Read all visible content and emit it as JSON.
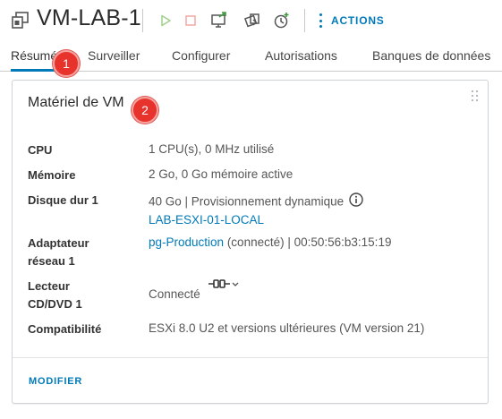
{
  "header": {
    "vm_name": "VM-LAB-1",
    "actions_label": "ACTIONS",
    "icons": [
      "vm-icon",
      "power-on-icon",
      "power-off-icon",
      "launch-console-icon",
      "migrate-icon",
      "snapshot-icon",
      "more-vertical-icon"
    ]
  },
  "tabs": [
    {
      "label": "Résumé",
      "active": true
    },
    {
      "label": "Surveiller"
    },
    {
      "label": "Configurer"
    },
    {
      "label": "Autorisations"
    },
    {
      "label": "Banques de données"
    }
  ],
  "callouts": [
    "1",
    "2"
  ],
  "card": {
    "title": "Matériel de VM",
    "rows": {
      "cpu": {
        "label": "CPU",
        "value": "1 CPU(s), 0 MHz utilisé"
      },
      "memory": {
        "label": "Mémoire",
        "value": "2 Go, 0 Go mémoire active"
      },
      "disk": {
        "label": "Disque dur 1",
        "value": "40 Go | Provisionnement dynamique",
        "link": "LAB-ESXI-01-LOCAL"
      },
      "network": {
        "label_line1": "Adaptateur",
        "label_line2": "réseau 1",
        "link": "pg-Production",
        "value": " (connecté) | 00:50:56:b3:15:19"
      },
      "cdrom": {
        "label_line1": "Lecteur",
        "label_line2": "CD/DVD 1",
        "value": "Connecté"
      },
      "compat": {
        "label": "Compatibilité",
        "value": "ESXi 8.0 U2 et versions ultérieures (VM version 21)"
      }
    },
    "modify_label": "MODIFIER"
  },
  "colors": {
    "accent": "#0079b8",
    "callout": "#e8322c",
    "disabled_icon": "#9fd08a"
  }
}
